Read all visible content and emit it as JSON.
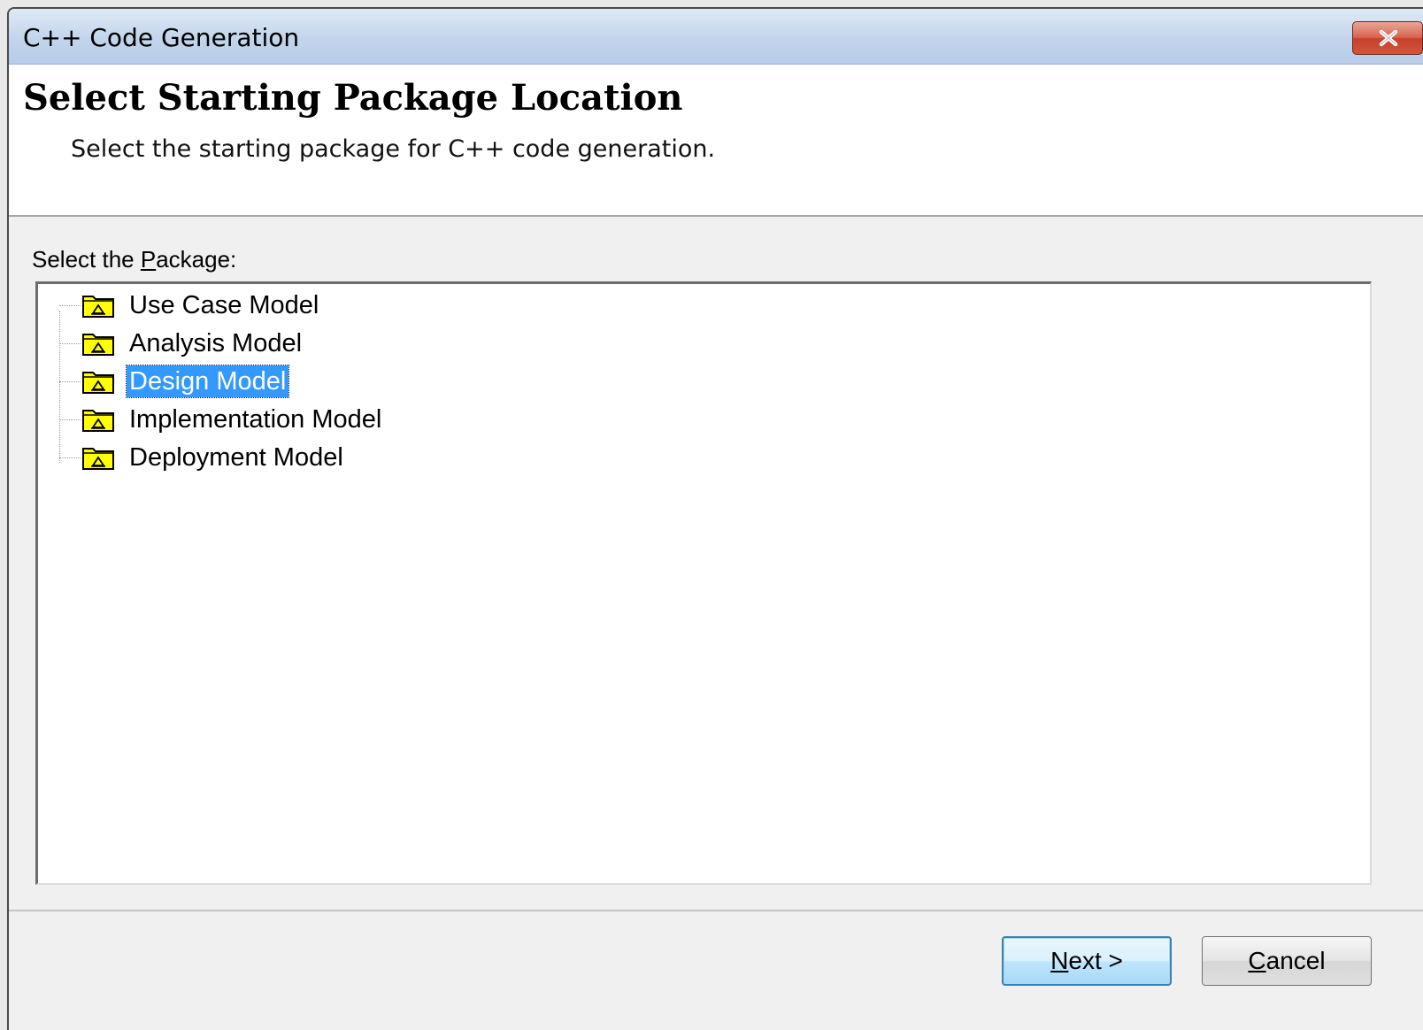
{
  "window": {
    "title": "C++ Code Generation"
  },
  "header": {
    "title": "Select Starting Package Location",
    "subtitle": "Select the starting package for C++ code generation."
  },
  "package_picker": {
    "label_prefix": "Select the ",
    "label_mnemonic": "P",
    "label_suffix": "ackage:",
    "items": [
      {
        "label": "Use Case Model",
        "icon": "package-folder-icon",
        "selected": false
      },
      {
        "label": "Analysis Model",
        "icon": "package-folder-icon",
        "selected": false
      },
      {
        "label": "Design Model",
        "icon": "package-folder-icon",
        "selected": true
      },
      {
        "label": "Implementation Model",
        "icon": "package-folder-icon",
        "selected": false
      },
      {
        "label": "Deployment Model",
        "icon": "package-folder-icon",
        "selected": false
      }
    ]
  },
  "buttons": {
    "next_mnemonic": "N",
    "next_rest": "ext >",
    "cancel_mnemonic": "C",
    "cancel_rest": "ancel"
  },
  "colors": {
    "selection": "#3399ff",
    "folder_fill": "#ffff00",
    "close_button": "#d0553c"
  }
}
